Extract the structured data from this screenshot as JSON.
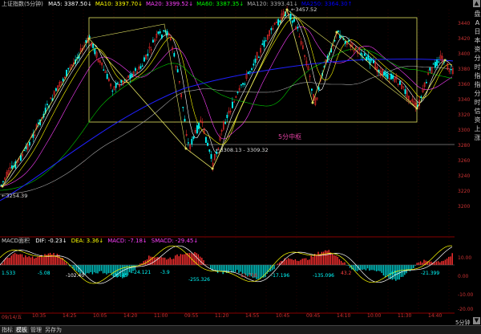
{
  "legend": {
    "title": "上证指数(5分钟)",
    "items": [
      {
        "label": "MA5: 3387.50",
        "arrow": "↓",
        "color": "#ffffff"
      },
      {
        "label": "MA10: 3397.70",
        "arrow": "↓",
        "color": "#ffff00"
      },
      {
        "label": "MA20: 3399.52",
        "arrow": "↓",
        "color": "#ff40ff"
      },
      {
        "label": "MA60: 3387.35",
        "arrow": "↓",
        "color": "#00ff00"
      },
      {
        "label": "MA120: 3393.41",
        "arrow": "↓",
        "color": "#aaaaaa"
      },
      {
        "label": "MA250: 3364.30",
        "arrow": "↑",
        "color": "#0000ff"
      }
    ]
  },
  "macd_legend": {
    "title": "MACD面积",
    "items": [
      {
        "label": "DIF: -0.23",
        "arrow": "↓",
        "color": "#ffffff"
      },
      {
        "label": "DEA: 3.36",
        "arrow": "↓",
        "color": "#ffff00"
      },
      {
        "label": "MACD: -7.18",
        "arrow": "↓",
        "color": "#ff40ff"
      },
      {
        "label": "SMACD: -29.45",
        "arrow": "↓",
        "color": "#ff40ff"
      }
    ]
  },
  "annotations": {
    "high": "3457.52",
    "low": "3254.39",
    "range": "3308.13 - 3309.32",
    "pivot": "5分中枢"
  },
  "right_axis": [
    "3440",
    "3420",
    "3400",
    "3380",
    "3360",
    "3340",
    "3320",
    "3300",
    "3280",
    "3260",
    "3240",
    "3220",
    "3200"
  ],
  "macd_axis": [
    "10.00",
    "0.00",
    "-10.00",
    "-20.00"
  ],
  "vertical_text": [
    "盘",
    "A",
    "日",
    "本",
    "资",
    "分",
    "时",
    "指",
    "指",
    "分",
    "时",
    "信",
    "资",
    "上",
    "涨"
  ],
  "x_ticks": [
    "09/14/五",
    "10:35",
    "14:25",
    "10:05",
    "14:20",
    "11:00",
    "09:55",
    "11:20",
    "14:55",
    "10:45",
    "09:45",
    "14:10",
    "10:00",
    "11:30",
    "14:40"
  ],
  "macd_values": [
    {
      "text": "1.533",
      "color": "#00ffff"
    },
    {
      "text": "-5.08",
      "color": "#00ffff"
    },
    {
      "text": "-102.40",
      "color": "#ffffff"
    },
    {
      "text": "-37.45",
      "color": "#00ffff"
    },
    {
      "text": "-24.121",
      "color": "#00ffff"
    },
    {
      "text": "-3.9",
      "color": "#00ffff"
    },
    {
      "text": "-255.326",
      "color": "#00ffff"
    },
    {
      "text": "11.716",
      "color": "#ff4040"
    },
    {
      "text": "-17.196",
      "color": "#00ffff"
    },
    {
      "text": "-135.096",
      "color": "#00ffff"
    },
    {
      "text": "43.2",
      "color": "#ff4040"
    },
    {
      "text": "-45",
      "color": "#00ffff"
    },
    {
      "text": "-21.399",
      "color": "#00ffff"
    }
  ],
  "period": "5分钟",
  "tabs": [
    "指标",
    "模板",
    "管理",
    "另存为"
  ],
  "colors": {
    "up": "#ff3030",
    "down": "#00ffff",
    "box": "#e0e060",
    "ma250": "#0000ff"
  }
}
